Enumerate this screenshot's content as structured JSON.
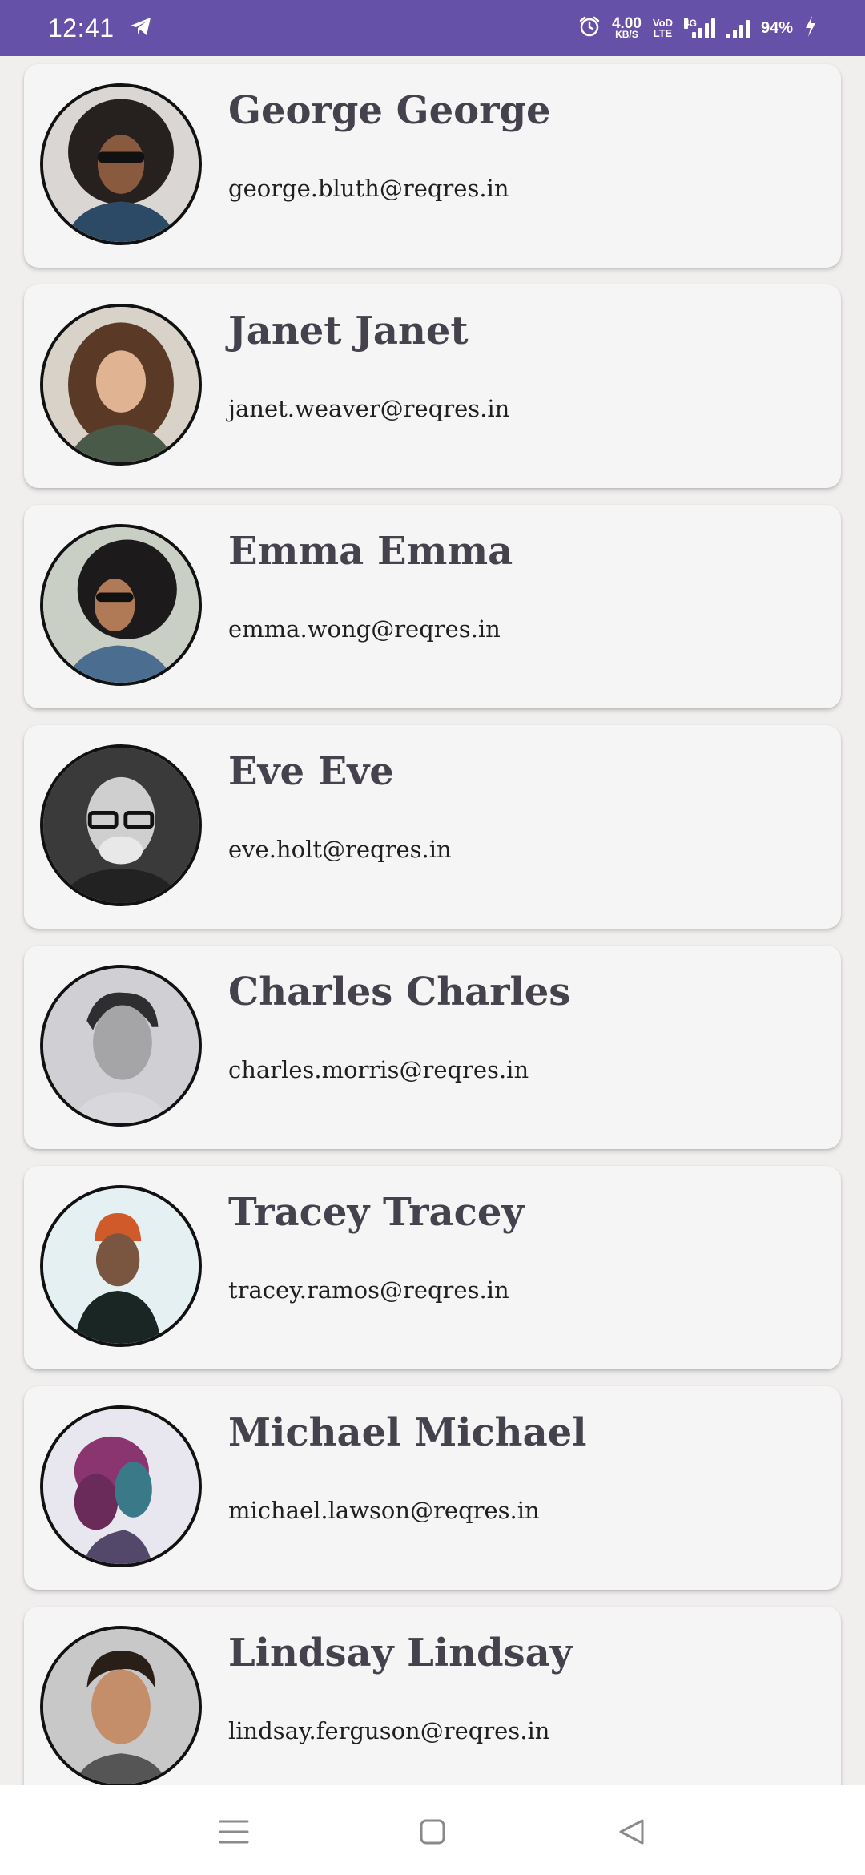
{
  "status_bar": {
    "time": "12:41",
    "net_speed_value": "4.00",
    "net_speed_unit": "KB/S",
    "volte_top": "VoD",
    "volte_bottom": "LTE",
    "network_type": "4G",
    "battery": "94%",
    "icons": [
      "telegram-icon",
      "alarm-icon",
      "signal-icon",
      "signal-icon",
      "charging-icon"
    ]
  },
  "colors": {
    "status_bar": "#6651a9",
    "card_background": "#f5f5f5",
    "page_background": "#f1eeee",
    "name_text": "#45424d"
  },
  "users": [
    {
      "name": "George George",
      "email": "george.bluth@reqres.in"
    },
    {
      "name": "Janet Janet",
      "email": "janet.weaver@reqres.in"
    },
    {
      "name": "Emma Emma",
      "email": "emma.wong@reqres.in"
    },
    {
      "name": "Eve Eve",
      "email": "eve.holt@reqres.in"
    },
    {
      "name": "Charles Charles",
      "email": "charles.morris@reqres.in"
    },
    {
      "name": "Tracey Tracey",
      "email": "tracey.ramos@reqres.in"
    },
    {
      "name": "Michael Michael",
      "email": "michael.lawson@reqres.in"
    },
    {
      "name": "Lindsay Lindsay",
      "email": "lindsay.ferguson@reqres.in"
    }
  ],
  "nav_bar": {
    "icons": [
      "menu-icon",
      "home-icon",
      "back-icon"
    ]
  }
}
